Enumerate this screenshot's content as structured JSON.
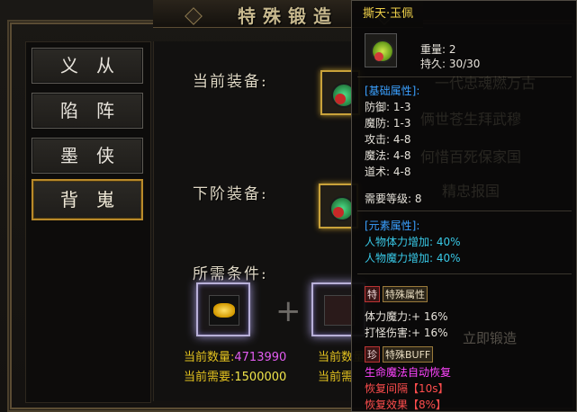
{
  "window": {
    "title": "特殊锻造"
  },
  "menu": {
    "items": [
      {
        "label": "义从",
        "active": false
      },
      {
        "label": "陷阵",
        "active": false
      },
      {
        "label": "墨侠",
        "active": false
      },
      {
        "label": "背嵬",
        "active": true
      }
    ]
  },
  "forge": {
    "current_label": "当前装备:",
    "next_label": "下阶装备:",
    "requirement_label": "所需条件:",
    "plus": "+",
    "current_qty_key": "当前数量:",
    "current_qty_val": "4713990",
    "need_key": "当前需要:",
    "need_val": "1500000",
    "second_qty_key": "当前数量",
    "second_need_key": "当前需"
  },
  "tooltip": {
    "name": "撕天·玉佩",
    "weight": "重量: 2",
    "durability": "持久: 30/30",
    "base_header": "[基础属性]:",
    "base_stats": [
      "防御: 1-3",
      "魔防: 1-3",
      "攻击: 4-8",
      "魔法: 4-8",
      "道术: 4-8"
    ],
    "level_req": "需要等级: 8",
    "element_header": "[元素属性]:",
    "element_stats": [
      "人物体力增加: 40%",
      "人物魔力增加: 40%"
    ],
    "special_tag": "特",
    "special_title": "特殊属性",
    "special_stats": [
      "体力魔力:+ 16%",
      "打怪伤害:+ 16%"
    ],
    "buff_tag": "珍",
    "buff_title": "特殊BUFF",
    "buff_lines": [
      "生命魔法自动恢复",
      "恢复间隔【10s】",
      "恢复效果【8%】"
    ],
    "ghost_lines": [
      "一代忠魂燃万古",
      "俩世苍生拜武穆",
      "何惜百死保家国",
      "精忠报国"
    ],
    "forge_button": "立即锻造"
  },
  "colors": {
    "accent": "#c9a23a",
    "active_border": "#b98a2a",
    "tooltip_bg": "#0a0908"
  }
}
